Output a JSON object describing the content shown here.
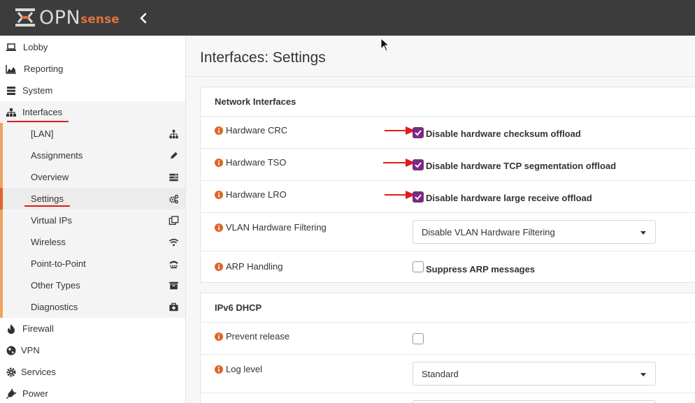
{
  "brand": {
    "logo_main": "OPN",
    "logo_sense": "sense"
  },
  "sidebar": {
    "items": [
      {
        "label": "Lobby",
        "icon": "laptop-icon"
      },
      {
        "label": "Reporting",
        "icon": "area-chart-icon"
      },
      {
        "label": "System",
        "icon": "server-icon"
      },
      {
        "label": "Interfaces",
        "icon": "sitemap-icon"
      }
    ],
    "sub_items": [
      {
        "label": "[LAN]",
        "icon": "sitemap-icon"
      },
      {
        "label": "Assignments",
        "icon": "pencil-icon"
      },
      {
        "label": "Overview",
        "icon": "tasks-icon"
      },
      {
        "label": "Settings",
        "icon": "cogs-icon"
      },
      {
        "label": "Virtual IPs",
        "icon": "clone-icon"
      },
      {
        "label": "Wireless",
        "icon": "wifi-icon"
      },
      {
        "label": "Point-to-Point",
        "icon": "tty-icon"
      },
      {
        "label": "Other Types",
        "icon": "archive-icon"
      },
      {
        "label": "Diagnostics",
        "icon": "medkit-icon"
      }
    ],
    "bottom_items": [
      {
        "label": "Firewall",
        "icon": "fire-icon"
      },
      {
        "label": "VPN",
        "icon": "globe-icon"
      },
      {
        "label": "Services",
        "icon": "cog-icon"
      },
      {
        "label": "Power",
        "icon": "plug-icon"
      }
    ]
  },
  "page": {
    "title": "Interfaces: Settings"
  },
  "network_interfaces": {
    "heading": "Network Interfaces",
    "rows": [
      {
        "label": "Hardware CRC",
        "checkbox_label": "Disable hardware checksum offload",
        "checked": true
      },
      {
        "label": "Hardware TSO",
        "checkbox_label": "Disable hardware TCP segmentation offload",
        "checked": true
      },
      {
        "label": "Hardware LRO",
        "checkbox_label": "Disable hardware large receive offload",
        "checked": true
      }
    ],
    "vlan": {
      "label": "VLAN Hardware Filtering",
      "value": "Disable VLAN Hardware Filtering"
    },
    "arp": {
      "label": "ARP Handling",
      "checkbox_label": "Suppress ARP messages",
      "checked": false
    }
  },
  "ipv6_dhcp": {
    "heading": "IPv6 DHCP",
    "prevent_release": {
      "label": "Prevent release",
      "checked": false
    },
    "log_level": {
      "label": "Log level",
      "value": "Standard"
    }
  },
  "colors": {
    "accent": "#e0632a",
    "checkbox": "#7b2a82",
    "annotation": "#e01b1b",
    "topbar": "#3c3c3c"
  }
}
